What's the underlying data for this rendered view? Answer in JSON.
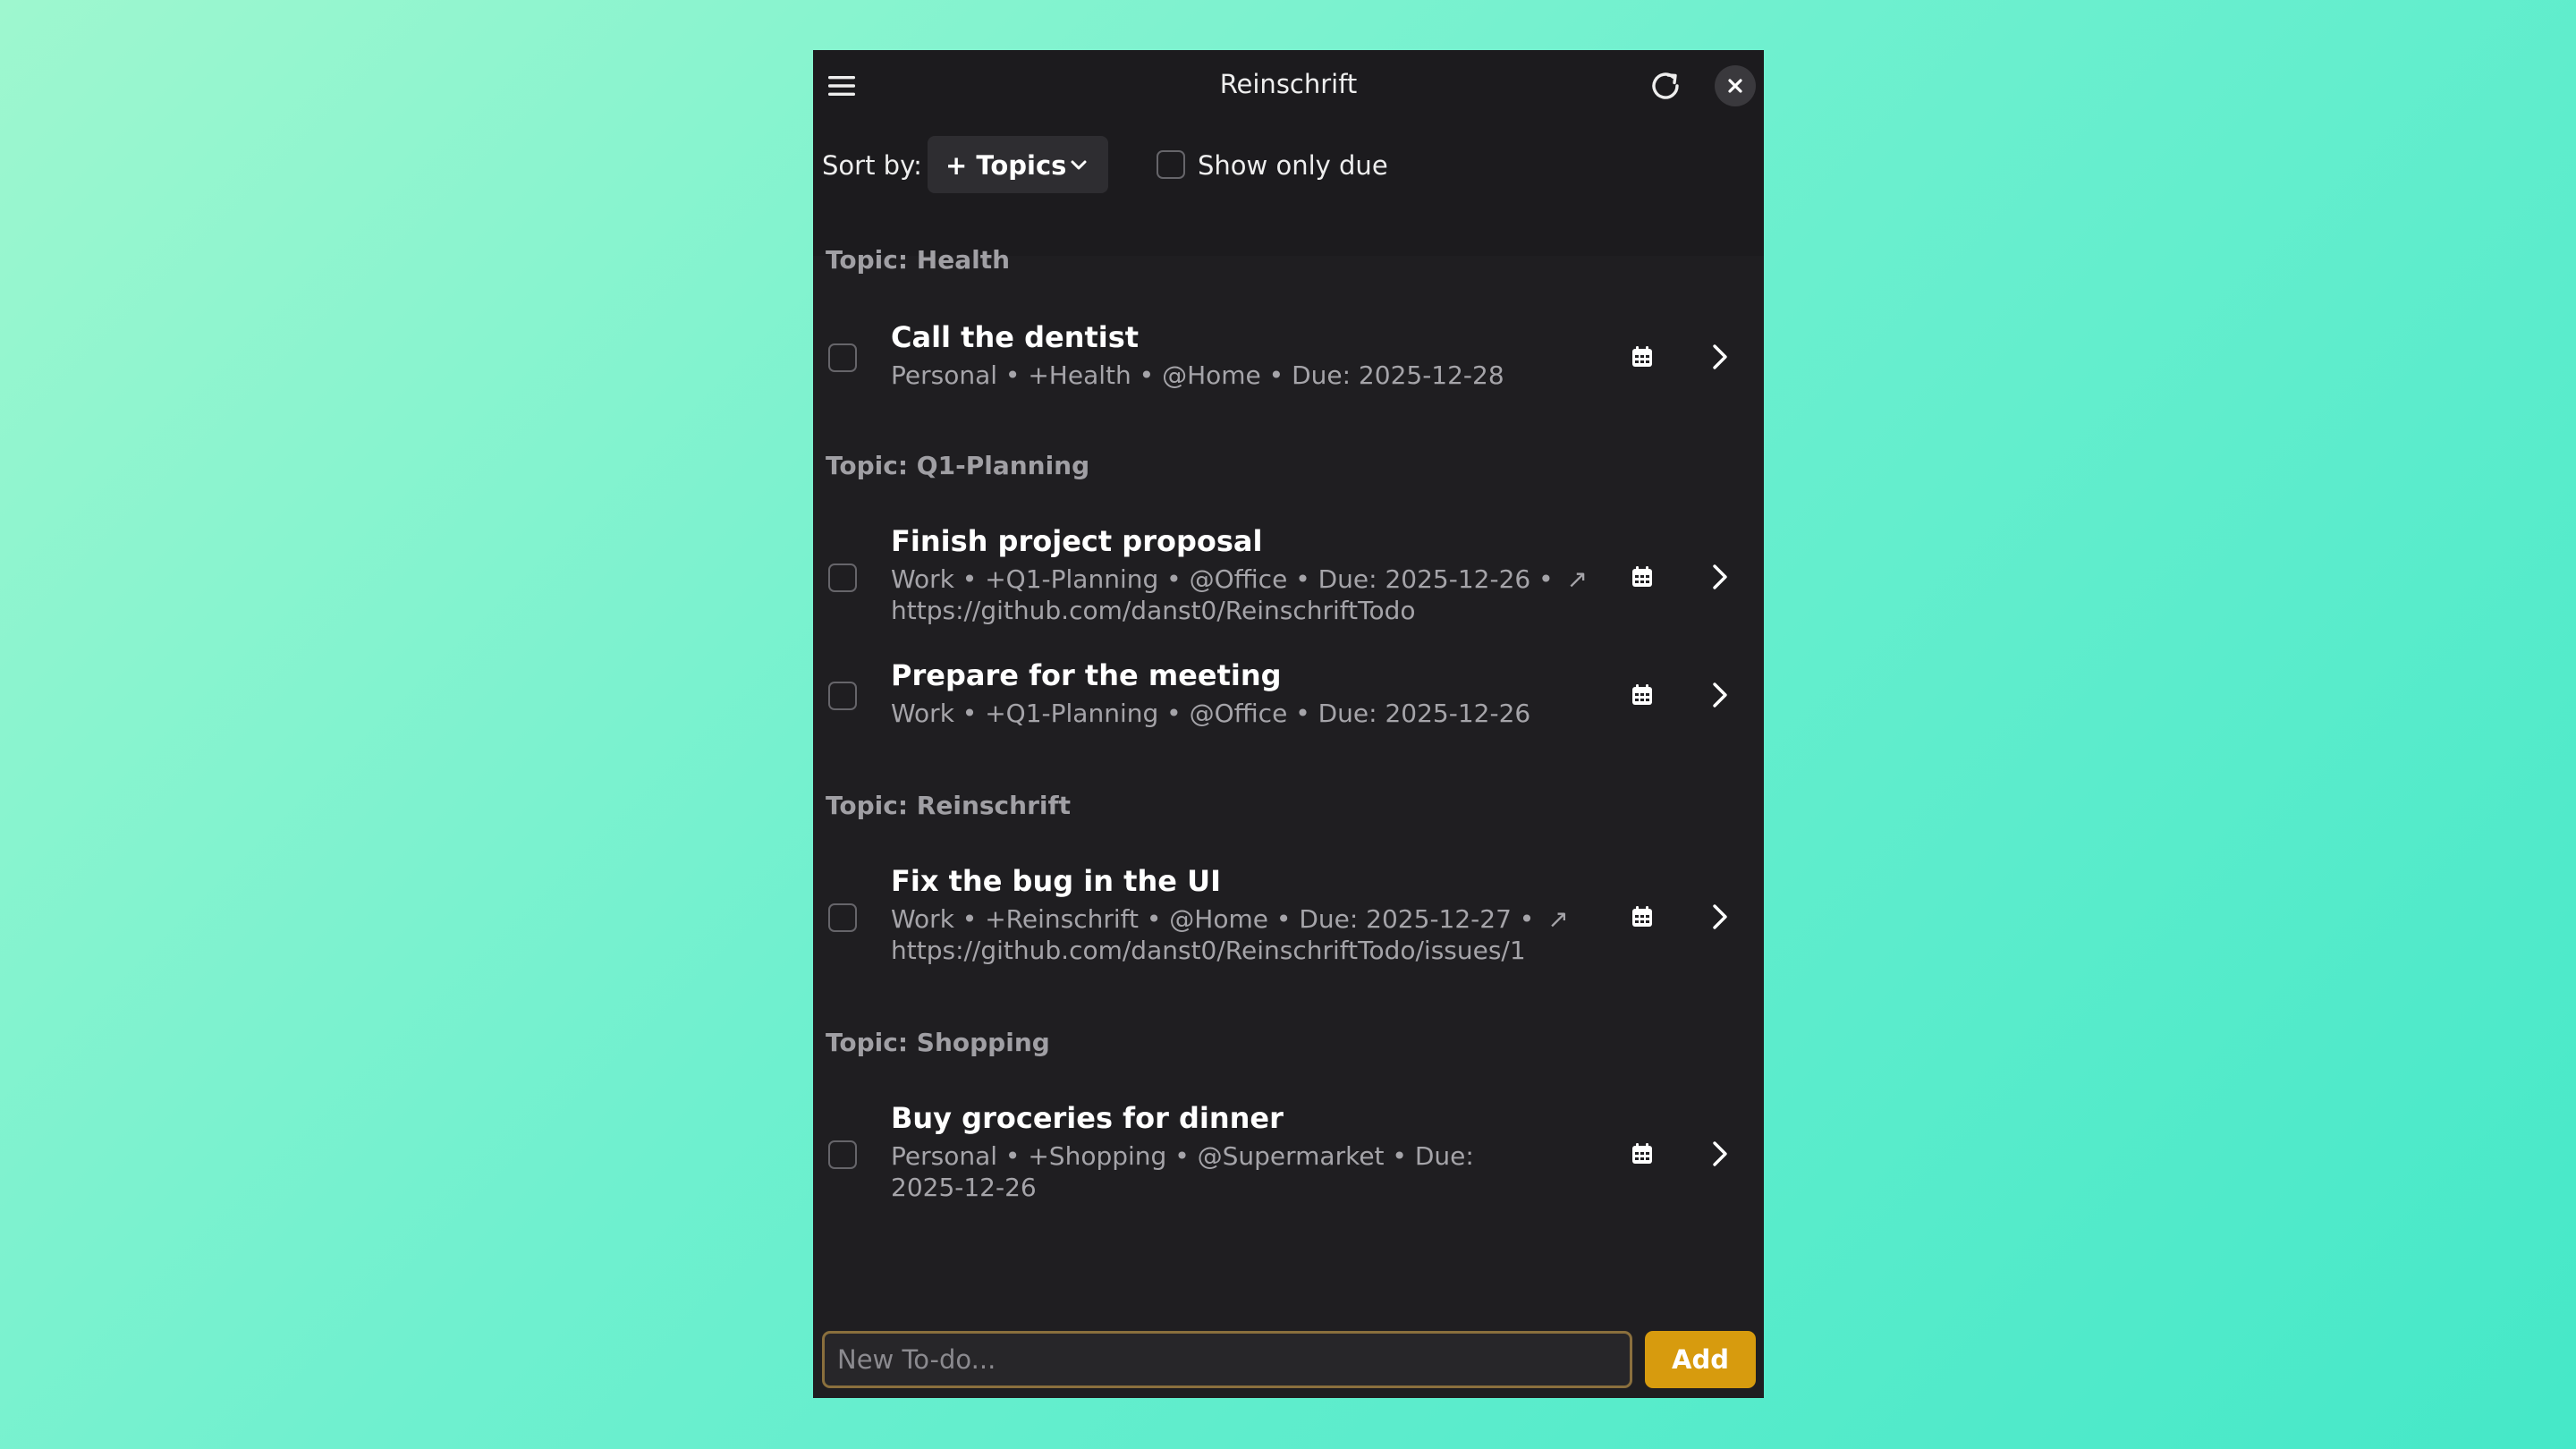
{
  "window": {
    "title": "Reinschrift"
  },
  "toolbar": {
    "sort_label": "Sort by:",
    "sort_value": "+ Topics",
    "show_only_due_label": "Show only due"
  },
  "groups": [
    {
      "header": "Topic: Health",
      "tasks": [
        {
          "title": "Call the dentist",
          "meta": "Personal • +Health • @Home • Due: 2025-12-28"
        }
      ]
    },
    {
      "header": "Topic: Q1-Planning",
      "tasks": [
        {
          "title": "Finish project proposal",
          "meta": "Work • +Q1-Planning • @Office • Due: 2025-12-26 •",
          "link": "https://github.com/danst0/ReinschriftTodo"
        },
        {
          "title": "Prepare for the meeting",
          "meta": "Work • +Q1-Planning • @Office • Due: 2025-12-26"
        }
      ]
    },
    {
      "header": "Topic: Reinschrift",
      "tasks": [
        {
          "title": "Fix the bug in the UI",
          "meta": "Work • +Reinschrift • @Home • Due: 2025-12-27 •",
          "link": "https://github.com/danst0/ReinschriftTodo/issues/1"
        }
      ]
    },
    {
      "header": "Topic: Shopping",
      "tasks": [
        {
          "title": "Buy groceries for dinner",
          "meta": "Personal • +Shopping • @Supermarket • Due: 2025-12-26"
        }
      ]
    }
  ],
  "new_todo": {
    "placeholder": "New To-do...",
    "value": ""
  },
  "add_button": {
    "label": "Add"
  },
  "colors": {
    "accent": "#d79b0e",
    "window_bg": "#1f1e21",
    "input_border": "#8a6f3d"
  }
}
